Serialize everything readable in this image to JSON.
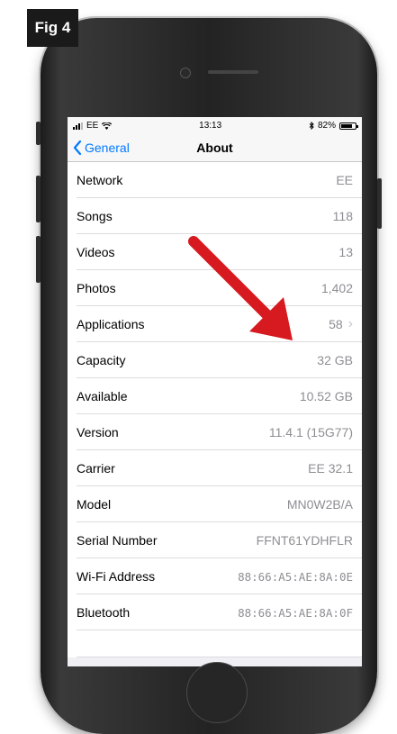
{
  "figure": {
    "label": "Fig 4"
  },
  "status_bar": {
    "carrier": "EE",
    "time": "13:13",
    "battery": "82%",
    "battery_level": 0.82
  },
  "nav": {
    "back_label": "General",
    "title": "About"
  },
  "rows": [
    {
      "label": "Network",
      "value": "EE"
    },
    {
      "label": "Songs",
      "value": "118"
    },
    {
      "label": "Videos",
      "value": "13"
    },
    {
      "label": "Photos",
      "value": "1,402"
    },
    {
      "label": "Applications",
      "value": "58"
    },
    {
      "label": "Capacity",
      "value": "32 GB"
    },
    {
      "label": "Available",
      "value": "10.52 GB"
    },
    {
      "label": "Version",
      "value": "11.4.1 (15G77)"
    },
    {
      "label": "Carrier",
      "value": "EE 32.1"
    },
    {
      "label": "Model",
      "value": "MN0W2B/A"
    },
    {
      "label": "Serial Number",
      "value": "FFNT61YDHFLR"
    },
    {
      "label": "Wi-Fi Address",
      "value": "88:66:A5:AE:8A:0E"
    },
    {
      "label": "Bluetooth",
      "value": "88:66:A5:AE:8A:0F"
    }
  ],
  "colors": {
    "ios_blue": "#007aff",
    "arrow_red": "#d71920"
  }
}
